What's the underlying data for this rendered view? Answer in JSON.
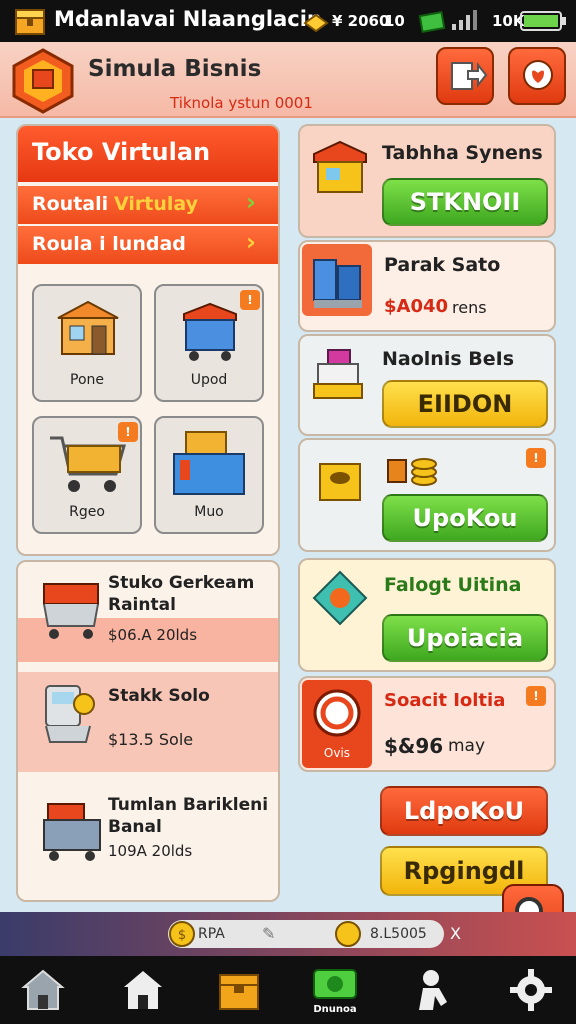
{
  "status_bar": {
    "title": "Mdanlavai Nlaanglacin",
    "resource_value": "¥ 2060",
    "resource_count": "10",
    "battery_text": "10K"
  },
  "header": {
    "title": "Simula Bisnis",
    "subtitle": "Tiknola ystun 0001"
  },
  "shop_panel": {
    "title": "Toko Virtulan",
    "rows": [
      {
        "label": "Routali",
        "highlight": "Virtulay"
      },
      {
        "label": "Roula i lundad",
        "highlight": ""
      }
    ],
    "tiles": [
      {
        "label": "Pone",
        "icon": "shop-stall-icon"
      },
      {
        "label": "Upod",
        "icon": "shop-cart-icon",
        "badge": "!"
      },
      {
        "label": "Rgeo",
        "icon": "shopping-cart-icon",
        "badge": "!"
      },
      {
        "label": "Muo",
        "icon": "crate-icon"
      }
    ]
  },
  "item_list": [
    {
      "name": "Stuko Gerkeam Raintal",
      "price": "$06.A 20lds"
    },
    {
      "name": "Stakk Solo",
      "price": "$13.5 Sole"
    },
    {
      "name": "Tumlan Barikleni Banal",
      "price": "109A 20lds"
    }
  ],
  "right_panel": [
    {
      "title": "Tabhha Synens",
      "button": "STKNOII",
      "style": "green"
    },
    {
      "title": "Parak Sato",
      "price": "$A040",
      "suffix": "rens"
    },
    {
      "title": "Naolnis BeIs",
      "button": "EIIDON",
      "style": "yellow"
    },
    {
      "button": "UpoKou",
      "style": "green",
      "badge": "!"
    },
    {
      "title": "Falogt Uitina",
      "button": "Upoiacia",
      "style": "green"
    },
    {
      "title": "Soacit Ioltia",
      "price": "$&96",
      "suffix": "may",
      "badge": "!",
      "icon_label": "Ovis"
    }
  ],
  "action_buttons": [
    {
      "label": "LdpoKoU",
      "style": "red"
    },
    {
      "label": "Rpgingdl",
      "style": "yellow"
    }
  ],
  "bottom_bar": {
    "coin_label": "RPA",
    "gold_amount": "8.L5005",
    "close": "X"
  },
  "nav": [
    {
      "icon": "home-outline-icon"
    },
    {
      "icon": "house-icon"
    },
    {
      "icon": "box-icon"
    },
    {
      "icon": "money-icon",
      "label": "Dnunoa"
    },
    {
      "icon": "worker-icon"
    },
    {
      "icon": "gear-icon"
    }
  ],
  "colors": {
    "accent": "#e8461c",
    "green": "#47b023",
    "yellow": "#f4c21e",
    "panel_bg": "#fbf3ea",
    "app_bg": "#d6e9f2"
  }
}
